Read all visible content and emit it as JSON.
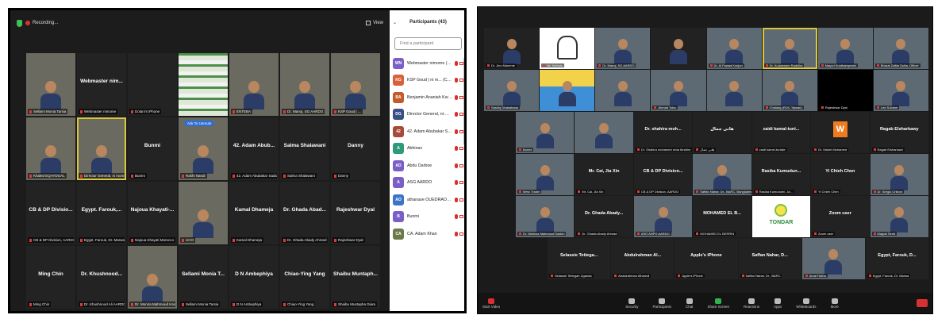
{
  "left": {
    "topbar": {
      "recording": "Recording...",
      "view_label": "View"
    },
    "grid": [
      {
        "label": "Sellami Monia Tarsia",
        "video": true
      },
      {
        "name": "Webmaster nim...",
        "label": "Webmaster nimome"
      },
      {
        "label": "Dolani's iPhone"
      },
      {
        "label": "",
        "logo": true
      },
      {
        "label": "ENTEBA",
        "video": true
      },
      {
        "label": "Dr. Manoj, SG AARDO",
        "video": true
      },
      {
        "label": "KSP Goud | ...",
        "video": true
      },
      {
        "label": "Khaled EQAYDGAL",
        "video": true
      },
      {
        "label": "Director General, ni momo",
        "video": true,
        "highlight": true
      },
      {
        "name": "Bunmi",
        "label": "Bunmi"
      },
      {
        "label": "Rakhi Nandi",
        "video": true,
        "badge": "Ask To Unmute"
      },
      {
        "name": "42. Adam Abub...",
        "label": "42. Adam Abubakar Sadiq G..."
      },
      {
        "name": "Salma Shalawani",
        "label": "Salma Shalawani"
      },
      {
        "name": "Danny",
        "label": "Danny"
      },
      {
        "name": "CB & DP Divisio...",
        "label": "CB & DP Division, AARDO"
      },
      {
        "name": "Egypt. Farouk,...",
        "label": "Egypt. Farouk, Dr. Marwa"
      },
      {
        "name": "Najoua Khayati-...",
        "label": "Najoua Khayati Morocco"
      },
      {
        "label": "UCO",
        "video": true
      },
      {
        "name": "Kamal Dhameja",
        "label": "Kamal Dhameja"
      },
      {
        "name": "Dr. Ghada Abad...",
        "label": "Dr. Ghada Abady Ahmed"
      },
      {
        "name": "Rajeshwar Dyal",
        "label": "Rajeshwar Dyal"
      },
      {
        "name": "Ming Chin",
        "label": "Ming Chin"
      },
      {
        "name": "Dr. Khushnood...",
        "label": "Dr. Khushnood Ali AARDO"
      },
      {
        "label": "Dr. Monira Mahmoud Kaskin",
        "video": true
      },
      {
        "name": "Sellami Monia T...",
        "label": "Sellami Monia Tarsia"
      },
      {
        "name": "D N Ambephiya",
        "label": "D N Ambephiya"
      },
      {
        "name": "Chiao-Ying Yang",
        "label": "Chiao-Ying Yang"
      },
      {
        "name": "Shaibu Muntaph...",
        "label": "Shaibu Mustapha Diara"
      }
    ],
    "sidebar": {
      "title": "Participants (43)",
      "search_placeholder": "Find a participant",
      "participants": [
        {
          "initials": "WN",
          "name": "Webmaster nimome (Host, me)",
          "color": "#7a5fc7"
        },
        {
          "initials": "KG",
          "name": "KSP Goud | ni m... (Co-Host)",
          "color": "#d8603a"
        },
        {
          "initials": "BA",
          "name": "Benjamin Ananiah Kwambo",
          "color": "#c45a2c"
        },
        {
          "initials": "DG",
          "name": "Director General, ni-mome",
          "color": "#3a4f86"
        },
        {
          "initials": "42",
          "name": "42. Adam Abubakar Sadiq (Gu...",
          "color": "#a84a3a"
        },
        {
          "initials": "A",
          "name": "Abhinav",
          "color": "#2e9a7a"
        },
        {
          "initials": "AD",
          "name": "Abdu Darboe",
          "color": "#7a5fc7"
        },
        {
          "initials": "A",
          "name": "ASG AARDO",
          "color": "#7a5fc7"
        },
        {
          "initials": "AO",
          "name": "athanase OUEDRAOGO",
          "color": "#3d74c8"
        },
        {
          "initials": "B",
          "name": "Bunmi",
          "color": "#7a5fc7"
        },
        {
          "initials": "CA",
          "name": "CA. Adam Khan",
          "color": "#6a7a4a"
        }
      ]
    }
  },
  "right": {
    "rows": [
      [
        {
          "label": "Dr. Jinx Maneme",
          "type": "logo"
        },
        {
          "label": "Mr. Nichols",
          "type": "sketch"
        },
        {
          "label": "Dr. Manoj, SG AARDO",
          "type": "video"
        },
        {
          "label": "",
          "type": "logo"
        },
        {
          "label": "Dr. Al Fawad Kunjun",
          "type": "video"
        },
        {
          "label": "Dr. Kulamwam Radhika",
          "type": "video",
          "highlight": true
        },
        {
          "label": "Mayuri Kurdkampmah",
          "type": "video"
        },
        {
          "label": "Bharat Zaffar Dutta, Officer",
          "type": "video"
        }
      ],
      [
        {
          "label": "Sashiq Dhabahadu",
          "type": "video"
        },
        {
          "label": "",
          "type": "cartoon"
        },
        {
          "label": "",
          "type": "video"
        },
        {
          "label": "Ahmad Toka",
          "type": "video"
        },
        {
          "label": "",
          "type": "video"
        },
        {
          "label": "Chaiang (ROC Taiwan)",
          "type": "video"
        },
        {
          "label": "Rajeshwar Dyal",
          "type": "black"
        },
        {
          "label": "Lee Suldam",
          "type": "video"
        }
      ],
      [
        {
          "label": "Bunmi",
          "type": "video"
        },
        {
          "label": "",
          "type": "video"
        },
        {
          "name": "Dr. shahira moh...",
          "label": "Dr. Shahira mohamed reda Ibrahim"
        },
        {
          "name": "هانى جمال",
          "label": "هانى جمال"
        },
        {
          "name": "zaidi kamal-tuni...",
          "label": "zaidi kamel-tunisie"
        },
        {
          "label": "Dr. Mahel Mohamed",
          "type": "w"
        },
        {
          "name": "Ragab Elsharkawy",
          "label": "Ragab Elsharkawi"
        }
      ],
      [
        {
          "label": "Meto Tradrit",
          "type": "video"
        },
        {
          "name": "Mr. Cai, Jia Xin",
          "label": "Mr. Cai, Jia Xin"
        },
        {
          "name": "CB & DP Division...",
          "label": "CB & DP Division, AARDO"
        },
        {
          "label": "Saffan Nahar, Dr., BARC, Bangladesh",
          "type": "video"
        },
        {
          "name": "Rasika Kumudun...",
          "label": "Rasika Kumudumi, Ja..."
        },
        {
          "name": "Yi Chieh Chen",
          "label": "Yi Chieh Chen"
        },
        {
          "label": "Dr. Sergio Chitoni",
          "type": "video"
        }
      ],
      [
        {
          "label": "Dr. Mahnaz Mahmoud Kaskin",
          "type": "video"
        },
        {
          "name": "Dr. Ghada Abady...",
          "label": "Dr. Ghada Abady Ahmad"
        },
        {
          "label": "ASG ANPO AARDO",
          "type": "video"
        },
        {
          "name": "MOHAMED EL B...",
          "label": "MOHAMED EL BERRIN"
        },
        {
          "label": "",
          "type": "tondar",
          "text": "TONDAR"
        },
        {
          "name": "Zoom user",
          "label": "Zoom user"
        },
        {
          "label": "Magda Serdi",
          "type": "video"
        }
      ],
      [
        {
          "name": "Selassie Tettega...",
          "label": "Selassie Tettegah Uganda"
        },
        {
          "name": "Abdulrahman Al...",
          "label": "Abdulrahman Alhamdi"
        },
        {
          "name": "Apple's iPhone",
          "label": "Apple's iPhone"
        },
        {
          "name": "Saffan Nahar, D...",
          "label": "Saffan Nahar, Dr., BARC"
        },
        {
          "label": "Amal Harba",
          "type": "video"
        },
        {
          "name": "Egypt, Farouk, D...",
          "label": "Egypt, Farouk, Dr. Marwa"
        }
      ]
    ],
    "toolbar": {
      "left": [
        {
          "label": "Start Video",
          "icon": "video-off-icon"
        }
      ],
      "center": [
        {
          "label": "Security",
          "icon": "shield-icon"
        },
        {
          "label": "Participants",
          "icon": "participants-icon"
        },
        {
          "label": "Chat",
          "icon": "chat-icon"
        },
        {
          "label": "Share Screen",
          "icon": "share-screen-icon"
        },
        {
          "label": "Reactions",
          "icon": "reactions-icon"
        },
        {
          "label": "Apps",
          "icon": "apps-icon"
        },
        {
          "label": "Whiteboards",
          "icon": "whiteboard-icon"
        },
        {
          "label": "More",
          "icon": "more-icon"
        }
      ]
    }
  }
}
